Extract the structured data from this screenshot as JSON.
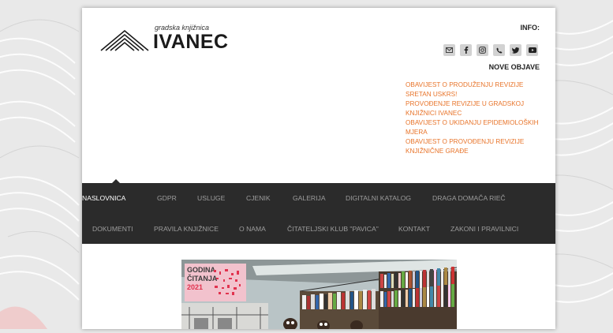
{
  "logo": {
    "small_text": "gradska knjižnica",
    "big_text": "IVANEC"
  },
  "info": {
    "title": "INFO:",
    "socials": [
      {
        "icon": "envelope-icon"
      },
      {
        "icon": "facebook-icon"
      },
      {
        "icon": "instagram-icon"
      },
      {
        "icon": "phone-icon"
      },
      {
        "icon": "twitter-icon"
      },
      {
        "icon": "youtube-icon"
      }
    ]
  },
  "news": {
    "title": "NOVE OBJAVE",
    "items": [
      "OBAVIJEST O PRODUŽENJU REVIZIJE",
      "SRETAN USKRS!",
      "PROVOĐENJE REVIZIJE U GRADSKOJ KNJIŽNICI IVANEC",
      "OBAVIJEST O UKIDANJU EPIDEMIOLOŠKIH MJERA",
      "OBAVIJEST O PROVOĐENJU REVIZIJE KNJIŽNIČNE GRAĐE"
    ],
    "color": "#e8742a"
  },
  "nav": {
    "row1": [
      "NASLOVNICA",
      "GDPR",
      "USLUGE",
      "CJENIK",
      "GALERIJA",
      "DIGITALNI KATALOG",
      "DRAGA DOMAČA RIEČ"
    ],
    "row2": [
      "DOKUMENTI",
      "PRAVILA KNJIŽNICE",
      "O NAMA",
      "ČITATELJSKI KLUB \"PAVICA\"",
      "KONTAKT",
      "ZAKONI I PRAVILNICI"
    ],
    "active": "NASLOVNICA"
  },
  "hero": {
    "label_line1": "GODINA",
    "label_line2": "ČITANJA",
    "label_line3": "2021"
  }
}
